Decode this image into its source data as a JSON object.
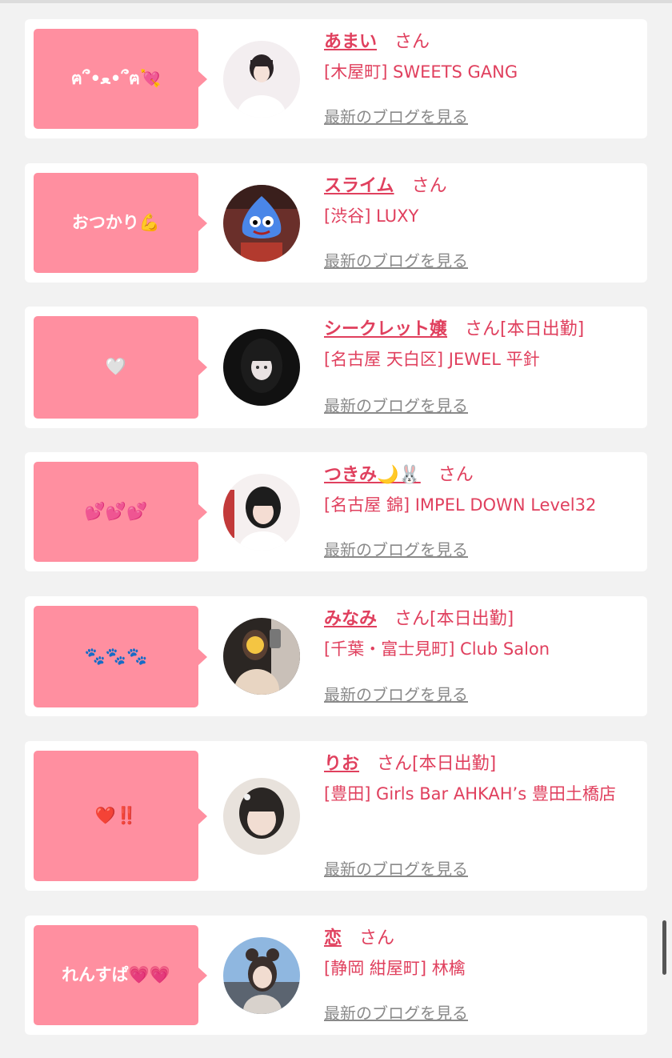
{
  "cards": [
    {
      "bubble": "ฅ՞•ﻌ•՞ฅ💘",
      "name": "あまい",
      "san": "さん",
      "status": "",
      "shop": "[木屋町] SWEETS GANG",
      "blog": "最新のブログを見る",
      "avatar_icon": "girl-portrait-icon",
      "avatar_colors": [
        "#f3eef0",
        "#2a2326",
        "#f5e1d8"
      ]
    },
    {
      "bubble": "おつかり💪",
      "name": "スライム",
      "san": "さん",
      "status": "",
      "shop": "[渋谷] LUXY",
      "blog": "最新のブログを見る",
      "avatar_icon": "slime-mascot-icon",
      "avatar_colors": [
        "#6a2f2a",
        "#4a86e8",
        "#d9d9d9"
      ]
    },
    {
      "bubble": "🤍",
      "name": "シークレット嬢",
      "san": "さん",
      "status": "[本日出勤]",
      "shop": "[名古屋 天白区] JEWEL 平針",
      "blog": "最新のブログを見る",
      "avatar_icon": "girl-portrait-icon",
      "avatar_colors": [
        "#111111",
        "#e9e2e2",
        "#222222"
      ]
    },
    {
      "bubble": "💕💕💕",
      "name": "つきみ🌙🐰",
      "san": "さん",
      "status": "",
      "shop": "[名古屋 錦] IMPEL DOWN Level32",
      "blog": "最新のブログを見る",
      "avatar_icon": "girl-portrait-icon",
      "avatar_colors": [
        "#f5f0f0",
        "#1d1d1d",
        "#f4ddd3"
      ]
    },
    {
      "bubble": "🐾🐾🐾",
      "name": "みなみ",
      "san": "さん",
      "status": "[本日出勤]",
      "shop": "[千葉・富士見町] Club Salon",
      "blog": "最新のブログを見る",
      "avatar_icon": "girl-selfie-icon",
      "avatar_colors": [
        "#2b2623",
        "#e8d5c2",
        "#c9c0b8"
      ]
    },
    {
      "bubble": "❤️‼️",
      "name": "りお",
      "san": "さん",
      "status": "[本日出勤]",
      "shop": "[豊田] Girls Bar AHKAH’s 豊田土橋店",
      "blog": "最新のブログを見る",
      "avatar_icon": "girl-portrait-icon",
      "avatar_colors": [
        "#e8e2dc",
        "#2a2624",
        "#f1ddd2"
      ]
    },
    {
      "bubble": "れんすぱ💗💗",
      "name": "恋",
      "san": "さん",
      "status": "",
      "shop": "[静岡 紺屋町] 林檎",
      "blog": "最新のブログを見る",
      "avatar_icon": "girl-outdoor-icon",
      "avatar_colors": [
        "#8fb7e0",
        "#3a2f2c",
        "#f1dcd0"
      ]
    }
  ],
  "theme": {
    "accent": "#e0405e",
    "bubble": "#ff8fa0",
    "link_gray": "#8a8a8a",
    "page_bg": "#f2f2f2"
  }
}
